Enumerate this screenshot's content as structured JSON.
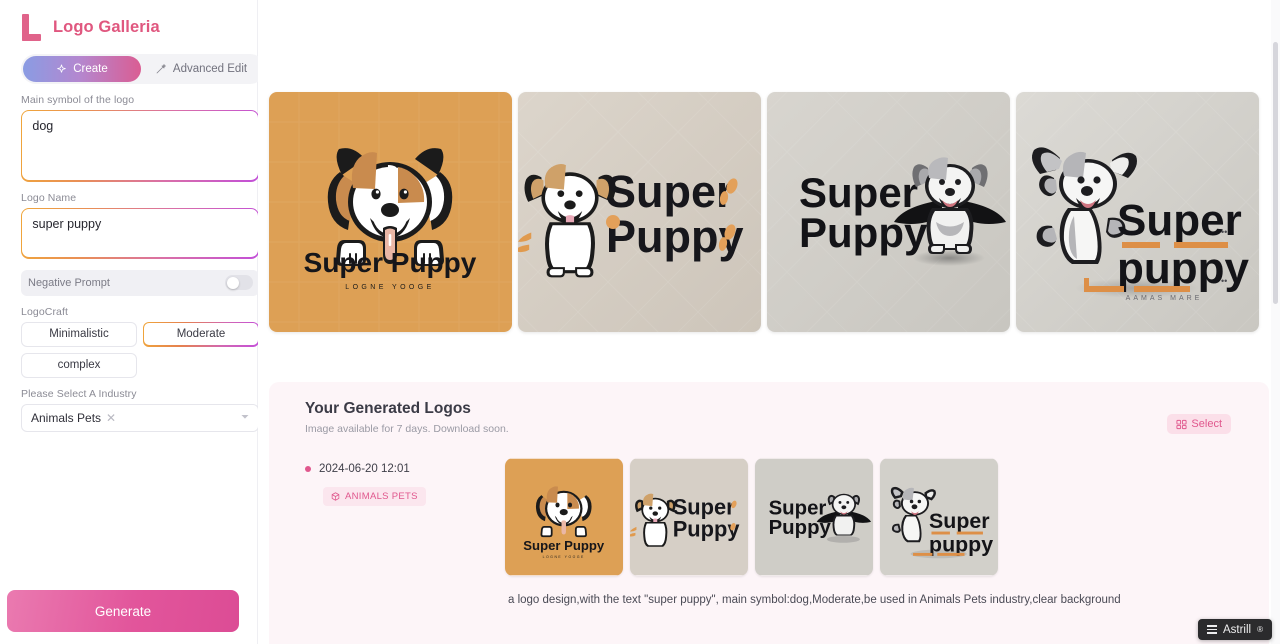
{
  "app": {
    "brand_name": "Logo Galleria",
    "brand_icon": "logo-L-mark"
  },
  "tabs": [
    {
      "id": "create",
      "label": "Create",
      "icon": "sparkle-icon",
      "active": true
    },
    {
      "id": "advanced-edit",
      "label": "Advanced Edit",
      "icon": "magic-wand-icon",
      "active": false
    }
  ],
  "sidebar": {
    "main_symbol": {
      "label": "Main symbol of the logo",
      "value": "dog"
    },
    "logo_name": {
      "label": "Logo Name",
      "value": "super puppy"
    },
    "negative_prompt": {
      "label": "Negative Prompt",
      "enabled": false
    },
    "logocraft": {
      "label": "LogoCraft",
      "options": [
        {
          "label": "Minimalistic",
          "selected": false
        },
        {
          "label": "Moderate",
          "selected": true
        },
        {
          "label": "complex",
          "selected": false
        }
      ]
    },
    "industry": {
      "label": "Please Select A Industry",
      "value": "Animals Pets",
      "clear_icon": "close-x-icon",
      "chevron_icon": "chevron-down-icon"
    },
    "generate_label": "Generate"
  },
  "hero_logos": [
    {
      "id": "logo-1",
      "alt": "Super Puppy dog face on tan background",
      "title": "Super Puppy",
      "subtitle": "LOGNE YOOGE",
      "bg": "#dda055"
    },
    {
      "id": "logo-2",
      "alt": "Standing puppy with Super Puppy text",
      "title_line1": "Super",
      "title_line2": "Puppy",
      "bg": "#d6cfc6"
    },
    {
      "id": "logo-3",
      "alt": "Super Puppy text with caped hero dog",
      "title_line1": "Super",
      "title_line2": "Puppy",
      "bg": "#cfcdc7"
    },
    {
      "id": "logo-4",
      "alt": "Leaping puppy with Super puppy text",
      "title_line1": "Super",
      "title_line2": "puppy",
      "subtitle": "A A M A S   M A R E",
      "bg": "#d2d0ca"
    }
  ],
  "results_panel": {
    "title": "Your Generated Logos",
    "subtitle": "Image available for 7 days. Download soon.",
    "select_label": "Select",
    "select_icon": "select-grid-icon",
    "entry": {
      "timestamp": "2024-06-20 12:01",
      "tag_label": "ANIMALS PETS",
      "tag_icon": "cube-icon"
    },
    "caption": "a logo design,with the text \"super puppy\", main symbol:dog,Moderate,be used in Animals Pets industry,clear background"
  },
  "overlay": {
    "astrill_label": "Astrill",
    "astrill_icon": "hamburger-icon"
  },
  "colors": {
    "brand_pink": "#e0577f",
    "accent_magenta": "#dc4c95",
    "gradient_start": "#f0a63a",
    "gradient_end": "#c44fd9"
  }
}
